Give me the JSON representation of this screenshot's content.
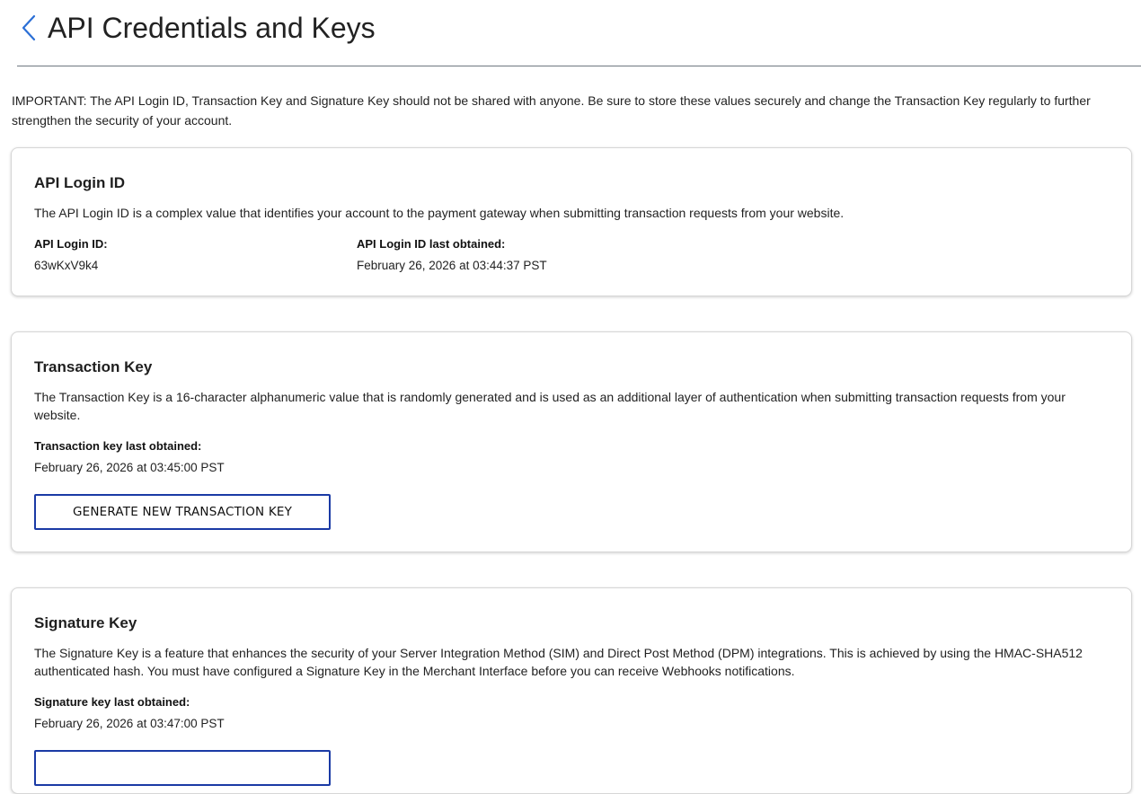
{
  "header": {
    "title": "API Credentials and Keys",
    "back_icon": "chevron-left-icon",
    "accent_color": "#2b6fd6"
  },
  "notice": "IMPORTANT: The API Login ID, Transaction Key and Signature Key should not be shared with anyone. Be sure to store these values securely and change the Transaction Key regularly to further strengthen the security of your account.",
  "login_card": {
    "title": "API Login ID",
    "description": "The API Login ID is a complex value that identifies your account to the payment gateway when submitting transaction requests from your website.",
    "id_label": "API Login ID:",
    "id_value": "63wKxV9k4",
    "obtained_label": "API Login ID last obtained:",
    "obtained_value": "February 26, 2026 at 03:44:37 PST"
  },
  "transaction_card": {
    "title": "Transaction Key",
    "description": "The Transaction Key is a 16-character alphanumeric value that is randomly generated and is used as an additional layer of authentication when submitting transaction requests from your website.",
    "obtained_label": "Transaction key last obtained:",
    "obtained_value": "February 26, 2026 at 03:45:00 PST",
    "button_label": "GENERATE NEW TRANSACTION KEY"
  },
  "signature_card": {
    "title": "Signature Key",
    "description": "The Signature Key is a feature that enhances the security of your Server Integration Method (SIM) and Direct Post Method (DPM) integrations. This is achieved by using the HMAC-SHA512 authenticated hash. You must have configured a Signature Key in the Merchant Interface before you can receive Webhooks notifications.",
    "obtained_label": "Signature key last obtained:",
    "obtained_value": "February 26, 2026 at 03:47:00 PST"
  },
  "colors": {
    "button_border": "#1a3aa5",
    "divider": "#6f7780"
  }
}
